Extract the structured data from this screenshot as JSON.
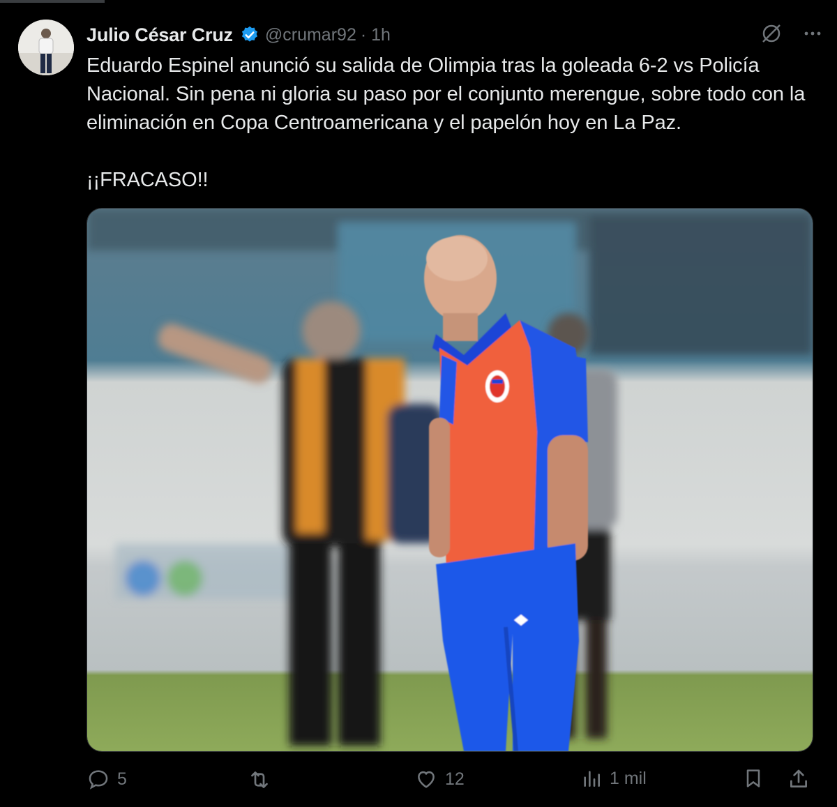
{
  "author": {
    "name": "Julio César Cruz",
    "handle": "@crumar92",
    "time": "· 1h",
    "verified": true
  },
  "tweet": {
    "text": "Eduardo Espinel anunció su salida de Olimpia tras la goleada 6-2 vs Policía Nacional. Sin pena ni gloria su paso por el conjunto merengue, sobre todo con la eliminación en Copa Centroamericana y el papelón hoy en La Paz.\n\n¡¡FRACASO!!"
  },
  "media": {
    "icons": [
      "coach-figure",
      "referee-figure",
      "player-figure"
    ]
  },
  "actions": {
    "replies": "5",
    "reposts": "",
    "likes": "12",
    "views": "1 mil"
  },
  "colors": {
    "background": "#000000",
    "text": "#e7e9ea",
    "muted": "#71767b",
    "verified": "#1d9bf0"
  }
}
